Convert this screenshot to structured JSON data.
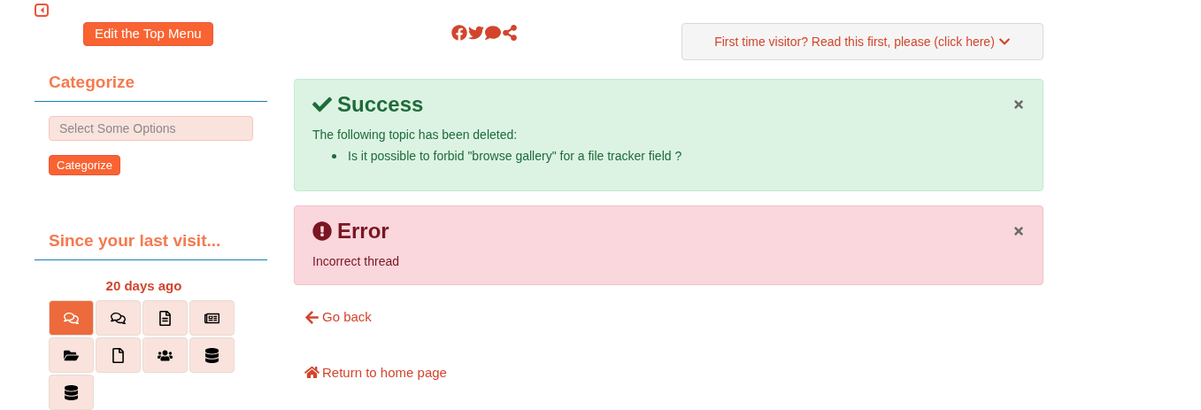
{
  "top_menu_button": "Edit the Top Menu",
  "categorize": {
    "title": "Categorize",
    "placeholder": "Select Some Options",
    "button": "Categorize"
  },
  "since_last_visit": {
    "title": "Since your last visit...",
    "time": "20 days ago",
    "tiles": [
      {
        "selected": true
      },
      {
        "selected": false
      },
      {
        "selected": false
      },
      {
        "selected": false
      },
      {
        "selected": false
      },
      {
        "selected": false
      },
      {
        "selected": false
      },
      {
        "selected": false
      },
      {
        "selected": false
      }
    ]
  },
  "visitor_button": "First time visitor? Read this first, please (click here)",
  "alerts": [
    {
      "kind": "success",
      "title": "Success",
      "text": "The following topic has been deleted:",
      "items": [
        "Is it possible to forbid \"browse gallery\" for a file tracker field ?"
      ]
    },
    {
      "kind": "error",
      "title": "Error",
      "text": "Incorrect thread"
    }
  ],
  "links": [
    {
      "kind": "back",
      "label": "Go back"
    },
    {
      "kind": "home",
      "label": "Return to home page"
    }
  ]
}
